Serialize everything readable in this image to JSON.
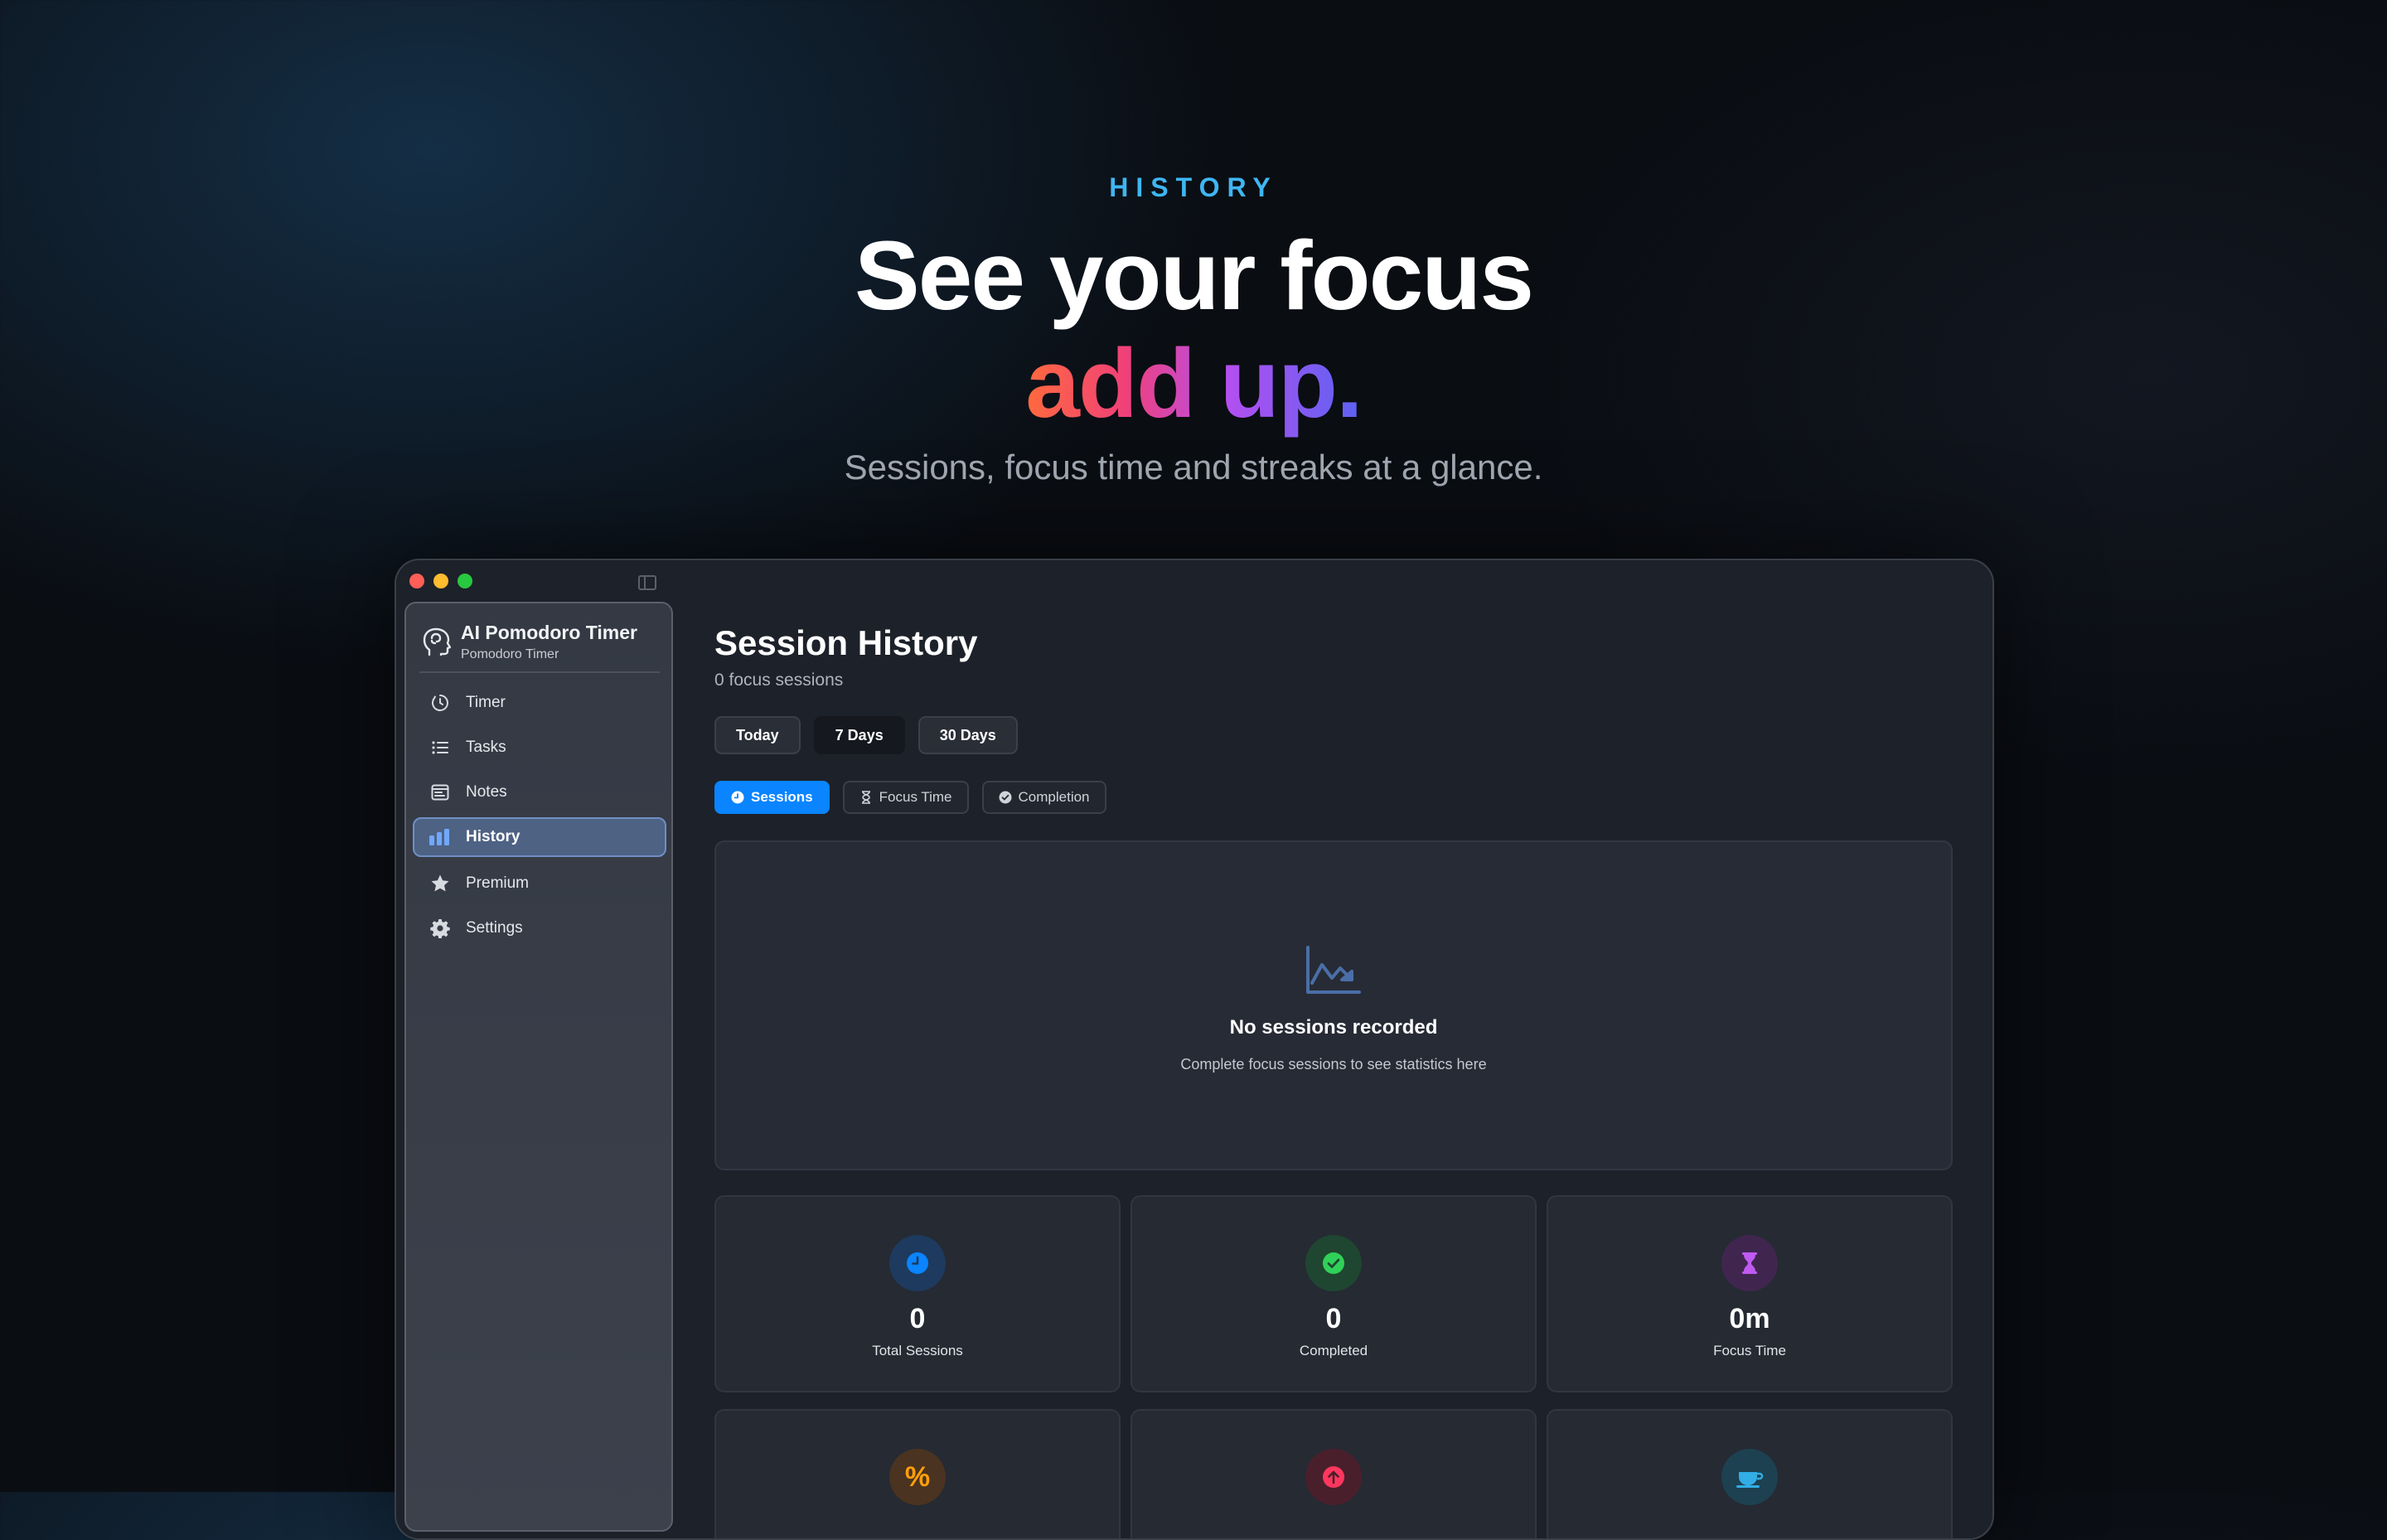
{
  "hero": {
    "eyebrow": "HISTORY",
    "headline_line1": "See your focus",
    "headline_line2": "add up.",
    "subhead": "Sessions, focus time and streaks at a glance."
  },
  "sidebar": {
    "app_title": "AI Pomodoro Timer",
    "app_subtitle": "Pomodoro Timer",
    "items": [
      {
        "label": "Timer",
        "icon": "timer-icon"
      },
      {
        "label": "Tasks",
        "icon": "list-icon"
      },
      {
        "label": "Notes",
        "icon": "notes-icon"
      },
      {
        "label": "History",
        "icon": "bar-chart-icon",
        "active": true
      },
      {
        "label": "Premium",
        "icon": "star-icon"
      },
      {
        "label": "Settings",
        "icon": "gear-icon"
      }
    ]
  },
  "main": {
    "title": "Session History",
    "subtitle": "0 focus sessions",
    "ranges": [
      {
        "label": "Today"
      },
      {
        "label": "7 Days",
        "selected": true
      },
      {
        "label": "30 Days"
      }
    ],
    "metrics": [
      {
        "label": "Sessions",
        "icon": "clock-icon",
        "selected": true
      },
      {
        "label": "Focus Time",
        "icon": "hourglass-icon"
      },
      {
        "label": "Completion",
        "icon": "check-circle-icon"
      }
    ],
    "empty_state": {
      "title": "No sessions recorded",
      "subtitle": "Complete focus sessions to see statistics here"
    },
    "stats": [
      {
        "value": "0",
        "label": "Total Sessions",
        "icon": "clock-icon",
        "color": "#0a84ff"
      },
      {
        "value": "0",
        "label": "Completed",
        "icon": "check-circle-icon",
        "color": "#30d158"
      },
      {
        "value": "0m",
        "label": "Focus Time",
        "icon": "hourglass-icon",
        "color": "#bf5af2"
      },
      {
        "icon": "percent-icon",
        "color": "#ff9f0a"
      },
      {
        "icon": "arrow-up-circle-icon",
        "color": "#ff375f"
      },
      {
        "icon": "cup-icon",
        "color": "#32ade6"
      }
    ]
  },
  "colors": {
    "accent": "#0a84ff",
    "eyebrow": "#3fb6f2",
    "gradient": [
      "#ff6a3d",
      "#f0407a",
      "#b44ff0",
      "#5b62f2"
    ]
  }
}
